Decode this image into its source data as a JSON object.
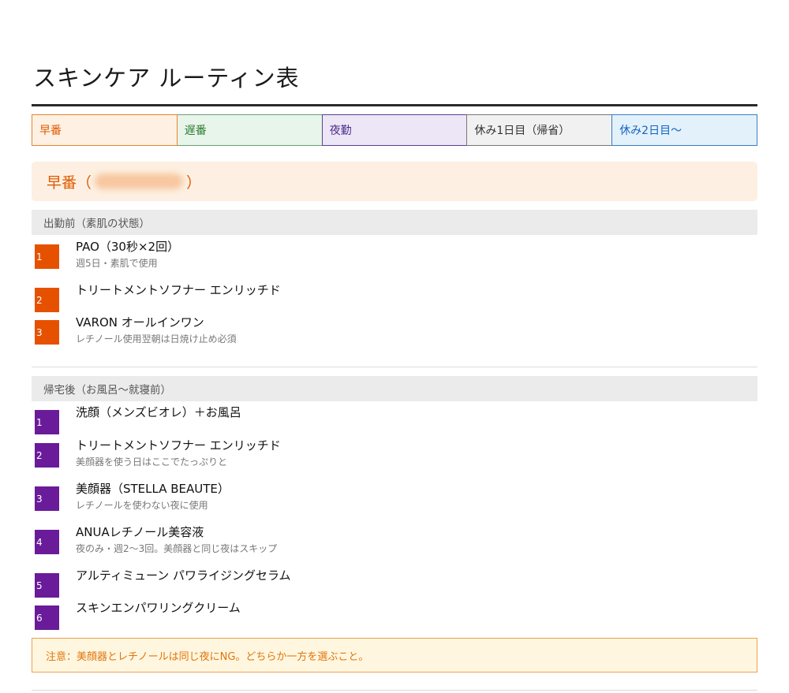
{
  "page_title": "スキンケア ルーティン表",
  "tabs": [
    {
      "label": "早番"
    },
    {
      "label": "遅番"
    },
    {
      "label": "夜勤"
    },
    {
      "label": "休み1日目（帰省）"
    },
    {
      "label": "休み2日目〜"
    }
  ],
  "shift": {
    "label_prefix": "早番（",
    "label_suffix": "）"
  },
  "sections": [
    {
      "heading": "出勤前（素肌の状態）",
      "steps": [
        {
          "num": "1",
          "name": "PAO（30秒×2回）",
          "note": "週5日・素肌で使用"
        },
        {
          "num": "2",
          "name": "トリートメントソフナー エンリッチド",
          "note": ""
        },
        {
          "num": "3",
          "name": "VARON オールインワン",
          "note": "レチノール使用翌朝は日焼け止め必須"
        }
      ]
    },
    {
      "heading": "帰宅後（お風呂〜就寝前）",
      "steps": [
        {
          "num": "1",
          "name": "洗顔（メンズビオレ）＋お風呂",
          "note": ""
        },
        {
          "num": "2",
          "name": "トリートメントソフナー エンリッチド",
          "note": "美顔器を使う日はここでたっぷりと"
        },
        {
          "num": "3",
          "name": "美顔器（STELLA BEAUTE）",
          "note": "レチノールを使わない夜に使用"
        },
        {
          "num": "4",
          "name": "ANUAレチノール美容液",
          "note": "夜のみ・週2〜3回。美顔器と同じ夜はスキップ"
        },
        {
          "num": "5",
          "name": "アルティミューン パワライジングセラム",
          "note": ""
        },
        {
          "num": "6",
          "name": "スキンエンパワリングクリーム",
          "note": ""
        }
      ]
    }
  ],
  "notice": "注意：美顔器とレチノールは同じ夜にNG。どちらか一方を選ぶこと。",
  "colors": {
    "early_accent": "#e05a00",
    "night_accent": "#6a1b9a",
    "notice_text": "#e0760a"
  }
}
